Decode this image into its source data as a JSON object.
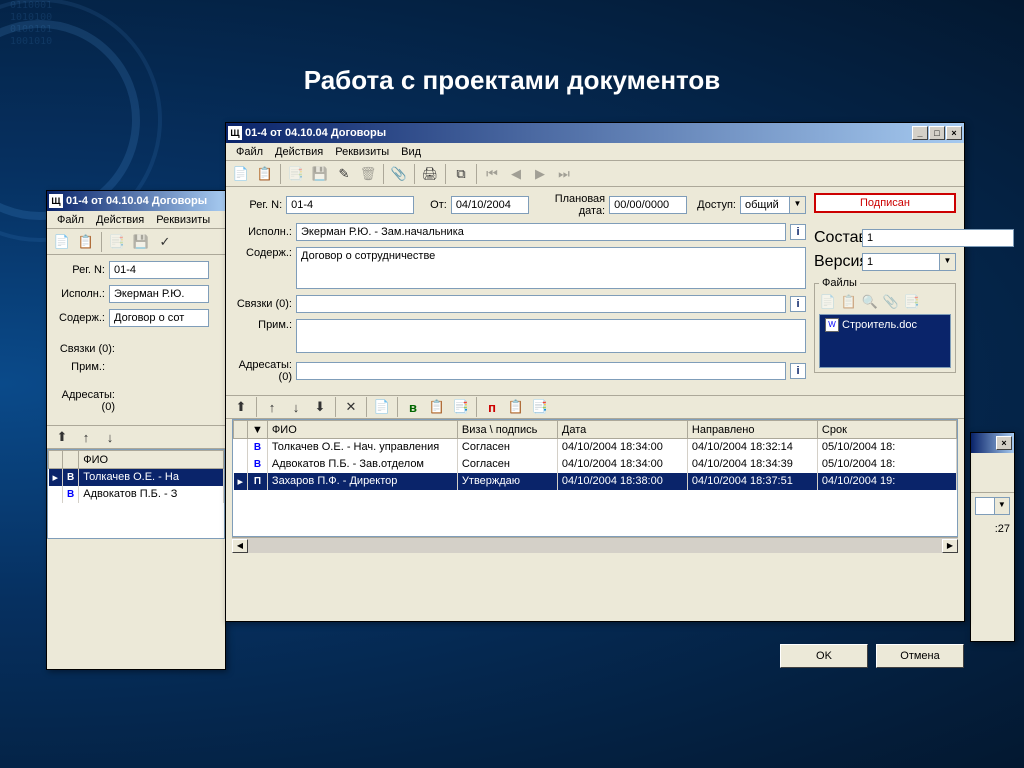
{
  "slide_title": "Работа с проектами документов",
  "win_title": "01-4 от 04.10.04 Договоры",
  "menus": {
    "file": "Файл",
    "actions": "Действия",
    "props": "Реквизиты",
    "view": "Вид"
  },
  "labels": {
    "reg_n": "Рег. N:",
    "from": "От:",
    "plan_date": "Плановая дата:",
    "access": "Доступ:",
    "ispoln": "Исполн.:",
    "soderz": "Содерж.:",
    "svyazki": "Связки (0):",
    "prim": "Прим.:",
    "adresaty": "Адресаты: (0)",
    "sostav": "Состав:",
    "versiya": "Версия:",
    "files": "Файлы"
  },
  "status_signed": "Подписан",
  "values": {
    "reg_n": "01-4",
    "from_date": "04/10/2004",
    "plan_date": "00/00/0000",
    "access": "общий",
    "ispoln": "Экерман Р.Ю. - Зам.начальника",
    "soderz": "Договор о сотрудничестве",
    "soderz_back": "Договор о сот",
    "ispoln_back": "Экерман Р.Ю.",
    "sostav": "1",
    "versiya": "1"
  },
  "file_item": "Строитель.doc",
  "grid": {
    "headers": {
      "fio": "ФИО",
      "visa": "Виза \\ подпись",
      "date": "Дата",
      "napravleno": "Направлено",
      "srok": "Срок"
    },
    "rows": [
      {
        "marker": "В",
        "mclass": "marker-b",
        "fio": "Толкачев О.Е. - Нач. управления",
        "visa": "Согласен",
        "date": "04/10/2004 18:34:00",
        "napr": "04/10/2004 18:32:14",
        "srok": "05/10/2004 18:"
      },
      {
        "marker": "В",
        "mclass": "marker-b",
        "fio": "Адвокатов П.Б. - Зав.отделом",
        "visa": "Согласен",
        "date": "04/10/2004 18:34:00",
        "napr": "04/10/2004 18:34:39",
        "srok": "05/10/2004 18:"
      },
      {
        "marker": "П",
        "mclass": "marker-p",
        "selected": true,
        "fio": "Захаров П.Ф. - Директор",
        "visa": "Утверждаю",
        "date": "04/10/2004 18:38:00",
        "napr": "04/10/2004 18:37:51",
        "srok": "04/10/2004 19:"
      }
    ],
    "back_rows": [
      {
        "marker": "В",
        "mclass": "marker-b",
        "selected": true,
        "fio": "Толкачев О.Е. - На"
      },
      {
        "marker": "В",
        "mclass": "marker-b",
        "fio": "Адвокатов П.Б. - З"
      }
    ],
    "back_header_fio": "ФИО"
  },
  "dlg": {
    "ok": "OK",
    "cancel": "Отмена"
  },
  "right_snippet": ":27"
}
